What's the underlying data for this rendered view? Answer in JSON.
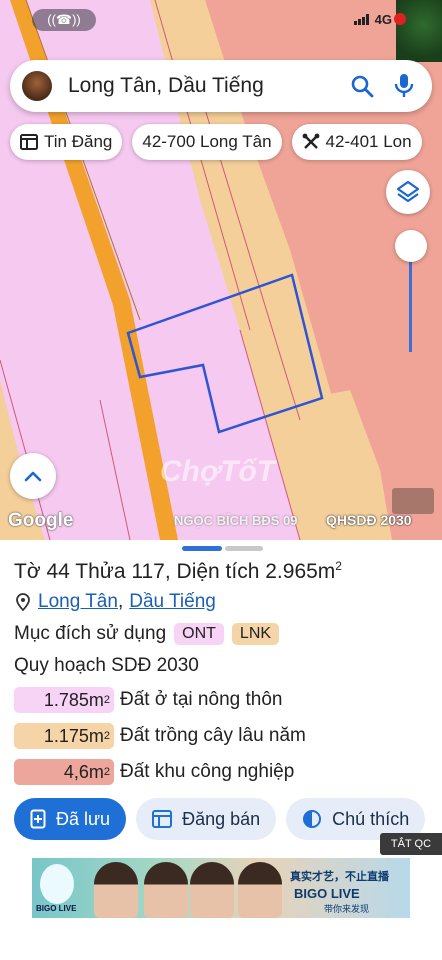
{
  "status_bar": {
    "network": "4G"
  },
  "search": {
    "query": "Long Tân, Dầu Tiếng"
  },
  "chips": [
    {
      "label": "Tin Đăng",
      "icon": "newspaper-icon"
    },
    {
      "label": "42-700 Long Tân",
      "icon": "none"
    },
    {
      "label": "42-401 Lon",
      "icon": "tools-icon"
    }
  ],
  "map": {
    "google_label": "Google",
    "watermark": "ChợTốT",
    "caption_left": "NGỌC BÍCH BĐS 09",
    "caption_right": "QHSDĐ 2030",
    "colors": {
      "residential": "#f6c9f0",
      "perennial": "#f5cf9a",
      "industrial": "#f0a497",
      "road": "#f2a22c",
      "parcel_outline": "#2f55d4"
    }
  },
  "parcel": {
    "to_label": "Tờ",
    "to_value": "44",
    "thua_label": "Thửa",
    "thua_value": "117",
    "area_label": "Diện tích",
    "area_value": "2.965m",
    "area_sup": "2",
    "ward": "Long Tân",
    "district": "Dầu Tiếng",
    "purpose_label": "Mục đích sử dụng",
    "purpose_tags": [
      "ONT",
      "LNK"
    ],
    "plan_label": "Quy hoạch SDĐ 2030",
    "areas": [
      {
        "value": "1.785m",
        "sup": "2",
        "label": "Đất ở tại nông thôn",
        "color": "#f7d3f5"
      },
      {
        "value": "1.175m",
        "sup": "2",
        "label": "Đất trồng cây lâu năm",
        "color": "#f5d5a8"
      },
      {
        "value": "4,6m",
        "sup": "2",
        "label": "Đất khu công nghiệp",
        "color": "#eda69b"
      }
    ]
  },
  "actions": {
    "saved": "Đã lưu",
    "post_sale": "Đăng bán",
    "legend": "Chú thích"
  },
  "ad": {
    "label": "TẮT QC",
    "logo_text": "BIGO LIVE",
    "cn_text": "真实才艺，不止直播",
    "brand": "BIGO LIVE",
    "sub": "带你来发现"
  }
}
